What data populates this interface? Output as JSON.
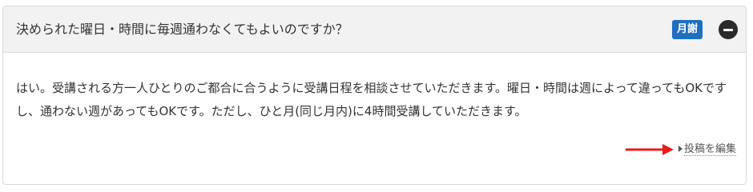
{
  "faq": {
    "question": "決められた曜日・時間に毎週通わなくてもよいのですか？",
    "category_badge": "月謝",
    "category_color": "#1e6fc0",
    "toggle_icon": "minus-circle-icon",
    "answer": "はい。受講される方一人ひとりのご都合に合うように受講日程を相談させていただきます。曜日・時間は週によって違ってもOKですし、通わない週があってもOKです。ただし、ひと月(同じ月内)に4時間受講していただきます。",
    "edit_link_label": "投稿を編集",
    "edit_link_icon": "caret-right-icon",
    "annotation_arrow_color": "#e81c1c"
  }
}
